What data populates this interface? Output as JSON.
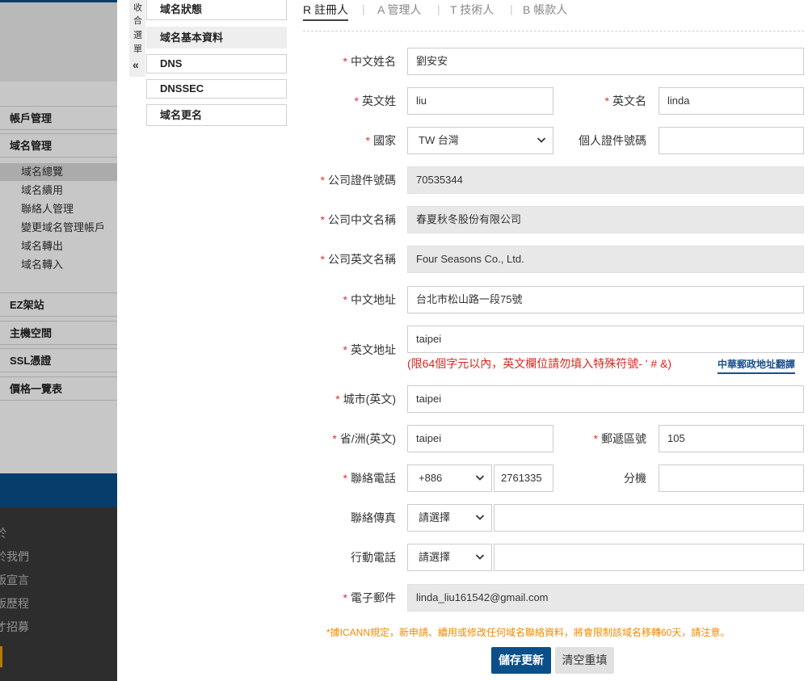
{
  "left_sidebar": {
    "account_mgmt": "帳戶管理",
    "domain_mgmt": "域名管理",
    "domain_sub_items": [
      "域名總覽",
      "域名續用",
      "聯絡人管理",
      "變更域名管理帳戶",
      "域名轉出",
      "域名轉入"
    ],
    "ez_site": "EZ架站",
    "host_space": "主機空間",
    "ssl": "SSL憑證",
    "price_list": "價格一覽表",
    "footer_links": [
      "於",
      "於我們",
      "版宣言",
      "版歷程",
      "才招募"
    ]
  },
  "collapse_menu": {
    "chars": [
      "收",
      "合",
      "選",
      "單"
    ],
    "arrow": "«"
  },
  "sub_menu": {
    "items": [
      "域名狀態",
      "域名基本資料",
      "DNS",
      "DNSSEC",
      "域名更名"
    ]
  },
  "tabs": [
    {
      "label": "R 註冊人"
    },
    {
      "label": "A 管理人"
    },
    {
      "label": "T 技術人"
    },
    {
      "label": "B 帳款人"
    }
  ],
  "tab_separator": "|",
  "required_mark": "*",
  "form": {
    "chinese_name": {
      "label": "中文姓名",
      "value": "劉安安"
    },
    "last_name_en": {
      "label": "英文姓",
      "value": "liu"
    },
    "first_name_en": {
      "label": "英文名",
      "value": "linda"
    },
    "country": {
      "label": "國家",
      "value": "TW 台灣"
    },
    "personal_id": {
      "label": "個人證件號碼",
      "value": ""
    },
    "company_id": {
      "label": "公司證件號碼",
      "value": "70535344"
    },
    "company_name_zh": {
      "label": "公司中文名稱",
      "value": "春夏秋冬股份有限公司"
    },
    "company_name_en": {
      "label": "公司英文名稱",
      "value": "Four Seasons Co., Ltd."
    },
    "address_zh": {
      "label": "中文地址",
      "value": "台北市松山路一段75號"
    },
    "address_en": {
      "label": "英文地址",
      "value": "taipei",
      "note": "(限64個字元以內，英文欄位請勿填入特殊符號- ' # &)",
      "translate_link": "中華郵政地址翻譯"
    },
    "city_en": {
      "label": "城市(英文)",
      "value": "taipei"
    },
    "province_en": {
      "label": "省/洲(英文)",
      "value": "taipei"
    },
    "postal_code": {
      "label": "郵遞區號",
      "value": "105"
    },
    "phone": {
      "label": "聯絡電話",
      "country_code": "+886",
      "value": "2761335"
    },
    "extension": {
      "label": "分機",
      "value": ""
    },
    "fax": {
      "label": "聯絡傳真",
      "select": "請選擇",
      "value": ""
    },
    "mobile": {
      "label": "行動電話",
      "select": "請選擇",
      "value": ""
    },
    "email": {
      "label": "電子郵件",
      "value": "linda_liu161542@gmail.com"
    }
  },
  "icann_note": "*據ICANN規定，新申請、續用或修改任何域名聯絡資料，將會限制該域名移轉60天，請注意。",
  "buttons": {
    "save": "儲存更新",
    "reset": "清空重填"
  },
  "icons": {
    "chevron": "chevron-down-icon",
    "collapse": "double-chevron-left-icon"
  },
  "colors": {
    "brand_blue": "#0a4f8a",
    "required_red": "#e0322d",
    "warning_orange": "#f08a00",
    "readonly_gray": "#e8e8e8"
  }
}
